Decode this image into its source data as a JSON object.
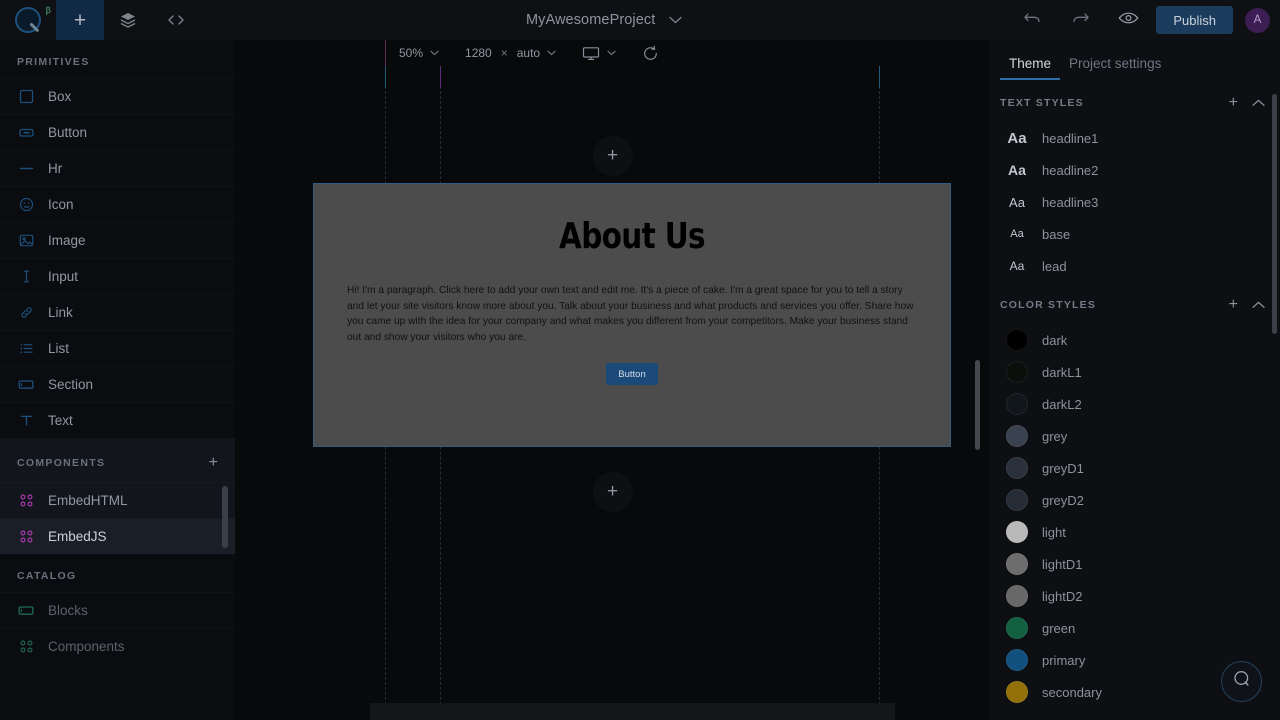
{
  "topbar": {
    "logo_badge": "β",
    "logo_icon": "app-logo",
    "add_label": "+",
    "layers_icon": "layers-icon",
    "code_icon": "code-icon",
    "project_title": "MyAwesomeProject",
    "project_caret": "chevron-down-icon",
    "undo_icon": "undo-icon",
    "redo_icon": "redo-icon",
    "preview_icon": "eye-icon",
    "publish_label": "Publish",
    "avatar_initial": "A"
  },
  "sidebar": {
    "primitives_title": "PRIMITIVES",
    "primitives": [
      {
        "label": "Box",
        "icon": "box-icon"
      },
      {
        "label": "Button",
        "icon": "button-icon"
      },
      {
        "label": "Hr",
        "icon": "hr-icon"
      },
      {
        "label": "Icon",
        "icon": "smiley-icon"
      },
      {
        "label": "Image",
        "icon": "image-icon"
      },
      {
        "label": "Input",
        "icon": "input-icon"
      },
      {
        "label": "Link",
        "icon": "link-icon"
      },
      {
        "label": "List",
        "icon": "list-icon"
      },
      {
        "label": "Section",
        "icon": "section-icon"
      },
      {
        "label": "Text",
        "icon": "text-icon"
      }
    ],
    "components_title": "COMPONENTS",
    "components_add": "+",
    "components": [
      {
        "label": "EmbedHTML",
        "icon": "component-icon"
      },
      {
        "label": "EmbedJS",
        "icon": "component-icon"
      }
    ],
    "catalog_title": "CATALOG",
    "catalog": [
      {
        "label": "Blocks",
        "icon": "blocks-icon"
      },
      {
        "label": "Components",
        "icon": "component-icon"
      }
    ]
  },
  "canvas": {
    "toolbar": {
      "zoom": "50%",
      "zoom_caret": "chevron-down-icon",
      "width": "1280",
      "times": "×",
      "height": "auto",
      "size_caret": "chevron-down-icon",
      "device_icon": "monitor-icon",
      "device_caret": "chevron-down-icon",
      "reload_icon": "refresh-icon"
    },
    "add_above_label": "+",
    "add_below_label": "+",
    "section": {
      "title": "About Us",
      "paragraph": "Hi! I'm a paragraph. Click here to add your own text and edit me. It's a piece of cake. I'm a great space for you to tell a story and let your site visitors know more about you. Talk about your business and what products and services you offer. Share how you came up with the idea for your company and what makes you different from your competitors. Make your business stand out and show your visitors who you are.",
      "button_label": "Button",
      "background_color": "#4c4c4c",
      "button_color": "#1b4a7a",
      "selection_color": "#2f5d85"
    }
  },
  "rightpanel": {
    "tabs": [
      {
        "label": "Theme",
        "active": true
      },
      {
        "label": "Project settings",
        "active": false
      }
    ],
    "text_styles_title": "TEXT STYLES",
    "text_styles_add": "+",
    "text_styles_collapse": "chevron-up-icon",
    "text_styles": [
      {
        "label": "headline1",
        "sample": "Aa",
        "size": 15,
        "weight": 700
      },
      {
        "label": "headline2",
        "sample": "Aa",
        "size": 14,
        "weight": 700
      },
      {
        "label": "headline3",
        "sample": "Aa",
        "size": 13,
        "weight": 400
      },
      {
        "label": "base",
        "sample": "Aa",
        "size": 11,
        "weight": 400
      },
      {
        "label": "lead",
        "sample": "Aa",
        "size": 12,
        "weight": 400
      }
    ],
    "color_styles_title": "COLOR STYLES",
    "color_styles_add": "+",
    "color_styles_collapse": "chevron-up-icon",
    "color_styles": [
      {
        "label": "dark",
        "color": "#000000"
      },
      {
        "label": "darkL1",
        "color": "#0a0f0c"
      },
      {
        "label": "darkL2",
        "color": "#11161a"
      },
      {
        "label": "grey",
        "color": "#39414f"
      },
      {
        "label": "greyD1",
        "color": "#2b313c"
      },
      {
        "label": "greyD2",
        "color": "#262c36"
      },
      {
        "label": "light",
        "color": "#b9b9b9"
      },
      {
        "label": "lightD1",
        "color": "#6d6d6d"
      },
      {
        "label": "lightD2",
        "color": "#686868"
      },
      {
        "label": "green",
        "color": "#11603f"
      },
      {
        "label": "primary",
        "color": "#11507f"
      },
      {
        "label": "secondary",
        "color": "#94700a"
      }
    ],
    "help_icon": "help-chat-icon"
  }
}
